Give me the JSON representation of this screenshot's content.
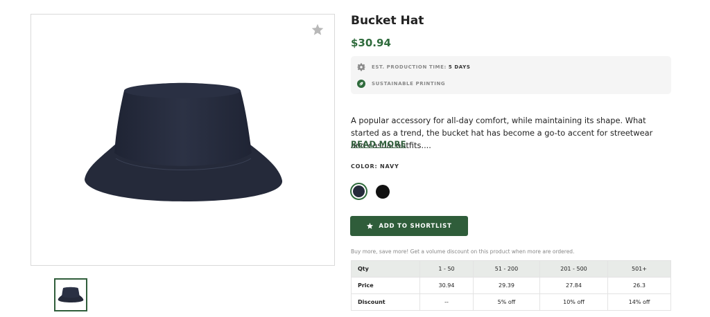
{
  "product": {
    "title": "Bucket Hat",
    "price": "$30.94",
    "image_alt": "Navy bucket hat"
  },
  "info": {
    "production_label": "EST. PRODUCTION TIME:",
    "production_value": "5 DAYS",
    "sustainable_label": "SUSTAINABLE PRINTING",
    "production_icon": "gear-icon",
    "sustainable_icon": "leaf-icon"
  },
  "description": {
    "text": "A popular accessory for all-day comfort, while maintaining its shape. What started as a trend, the bucket hat has become a go-to accent for streetwear and casual outfits....",
    "read_more": "READ MORE"
  },
  "color": {
    "label": "COLOR: NAVY",
    "options": [
      {
        "name": "Navy",
        "hex": "#262b3b",
        "selected": true
      },
      {
        "name": "Black",
        "hex": "#111111",
        "selected": false
      }
    ]
  },
  "actions": {
    "shortlist_label": "ADD TO SHORTLIST",
    "favorite_icon": "star-icon"
  },
  "volume": {
    "note": "Buy more, save more! Get a volume discount on this product when more are ordered.",
    "headers": [
      "Qty",
      "1 - 50",
      "51 - 200",
      "201 - 500",
      "501+"
    ],
    "rows": [
      [
        "Price",
        "30.94",
        "29.39",
        "27.84",
        "26.3"
      ],
      [
        "Discount",
        "--",
        "5% off",
        "10% off",
        "14% off"
      ]
    ]
  },
  "colors": {
    "accent": "#2f5d3a",
    "price": "#2f6b3c",
    "hat": "#262b3b"
  }
}
